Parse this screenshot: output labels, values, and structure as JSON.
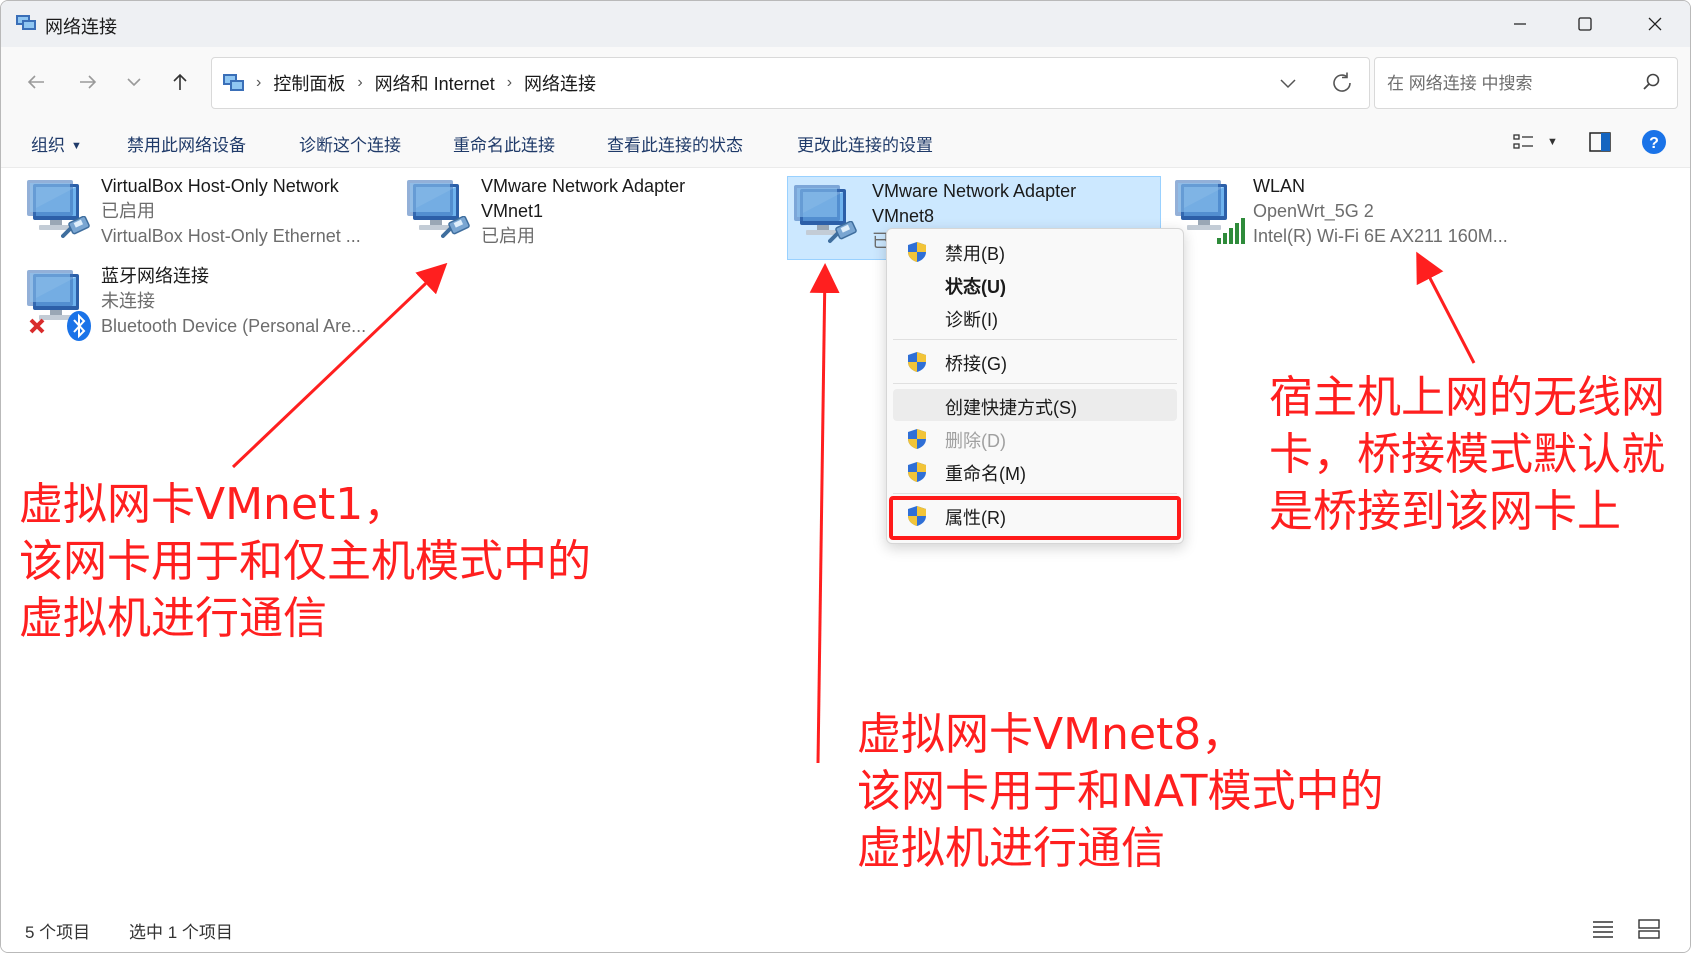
{
  "window": {
    "title": "网络连接"
  },
  "nav": {
    "breadcrumbs": [
      "控制面板",
      "网络和 Internet",
      "网络连接"
    ],
    "search_placeholder": "在 网络连接 中搜索"
  },
  "commandbar": {
    "organize": "组织",
    "disable": "禁用此网络设备",
    "diagnose": "诊断这个连接",
    "rename": "重命名此连接",
    "status": "查看此连接的状态",
    "settings": "更改此连接的设置"
  },
  "items": [
    {
      "name": "VirtualBox Host-Only Network",
      "line2": "已启用",
      "line3": "VirtualBox Host-Only Ethernet ..."
    },
    {
      "name": "VMware Network Adapter",
      "line2": "VMnet1",
      "line3": "已启用"
    },
    {
      "name": "VMware Network Adapter",
      "line2": "VMnet8",
      "line3": "已"
    },
    {
      "name": "WLAN",
      "line2": "OpenWrt_5G 2",
      "line3": "Intel(R) Wi-Fi 6E AX211 160M..."
    },
    {
      "name": "蓝牙网络连接",
      "line2": "未连接",
      "line3": "Bluetooth Device (Personal Are..."
    }
  ],
  "context_menu": [
    {
      "label": "禁用(B)",
      "shield": true
    },
    {
      "label": "状态(U)",
      "bold": true
    },
    {
      "label": "诊断(I)"
    },
    {
      "label": "桥接(G)",
      "shield": true
    },
    {
      "label": "创建快捷方式(S)"
    },
    {
      "label": "删除(D)",
      "shield": true,
      "disabled": true
    },
    {
      "label": "重命名(M)",
      "shield": true
    },
    {
      "label": "属性(R)",
      "shield": true
    }
  ],
  "annotations": {
    "vmnet1": [
      "虚拟网卡VMnet1，",
      "该网卡用于和仅主机模式中的",
      "虚拟机进行通信"
    ],
    "vmnet8": [
      "虚拟网卡VMnet8，",
      "该网卡用于和NAT模式中的",
      "虚拟机进行通信"
    ],
    "wlan": [
      "宿主机上网的无线网",
      "卡，桥接模式默认就",
      "是桥接到该网卡上"
    ]
  },
  "colors": {
    "annotation": "#ff1f1f",
    "selection": "#cce8ff",
    "link": "#1f3a69"
  },
  "statusbar": {
    "count": "5 个项目",
    "selected": "选中 1 个项目"
  }
}
